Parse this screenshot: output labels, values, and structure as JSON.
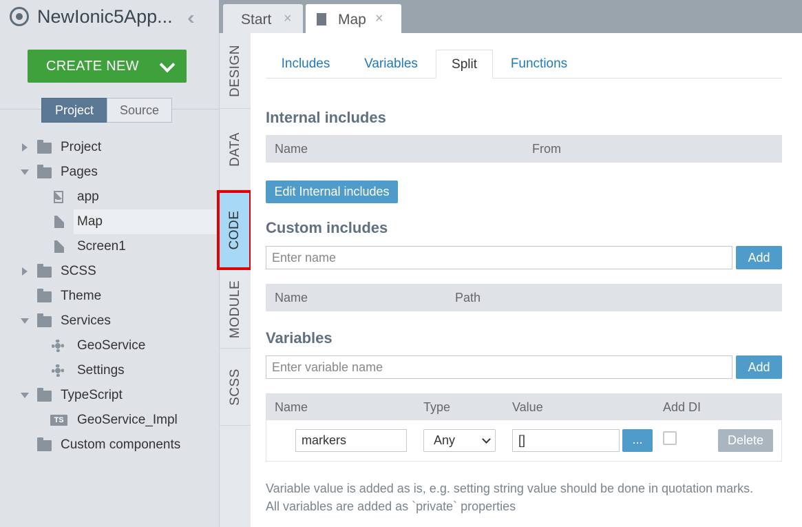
{
  "app": {
    "title": "NewIonic5App...",
    "create_new_label": "CREATE NEW"
  },
  "project_switch": {
    "project_label": "Project",
    "source_label": "Source",
    "selected": "Project"
  },
  "tree": {
    "project": "Project",
    "pages": "Pages",
    "app": "app",
    "map": "Map",
    "screen1": "Screen1",
    "scss": "SCSS",
    "theme": "Theme",
    "services": "Services",
    "geoservice": "GeoService",
    "settings": "Settings",
    "typescript": "TypeScript",
    "geoservice_impl": "GeoService_Impl",
    "custom_components": "Custom components",
    "ts_badge": "TS"
  },
  "vertical_tabs": {
    "design": "DESIGN",
    "data": "DATA",
    "code": "CODE",
    "module": "MODULE",
    "scss": "SCSS",
    "active": "CODE"
  },
  "doc_tabs": {
    "start": "Start",
    "map": "Map",
    "close_glyph": "×",
    "active": "Map"
  },
  "sub_tabs": {
    "includes": "Includes",
    "variables": "Variables",
    "split": "Split",
    "functions": "Functions",
    "active": "Split"
  },
  "internal_includes": {
    "title": "Internal includes",
    "col_name": "Name",
    "col_from": "From",
    "edit_button": "Edit Internal includes"
  },
  "custom_includes": {
    "title": "Custom includes",
    "input_placeholder": "Enter name",
    "add_button": "Add",
    "col_name": "Name",
    "col_path": "Path"
  },
  "variables": {
    "title": "Variables",
    "input_placeholder": "Enter variable name",
    "add_button": "Add",
    "col_name": "Name",
    "col_type": "Type",
    "col_value": "Value",
    "col_add_di": "Add DI",
    "rows": [
      {
        "name": "markers",
        "type": "Any",
        "value": "[]",
        "more_button": "...",
        "add_di": false,
        "delete_button": "Delete"
      }
    ]
  },
  "note": {
    "line1": "Variable value is added as is, e.g. setting string value should be done in quotation marks.",
    "line2": "All variables are added as `private` properties"
  },
  "colors": {
    "create_green": "#3ea13b",
    "link_blue": "#1e7ab8",
    "button_blue": "#4f9bc9",
    "active_vtab": "#a7d8f6",
    "highlight_red": "#e20000"
  }
}
